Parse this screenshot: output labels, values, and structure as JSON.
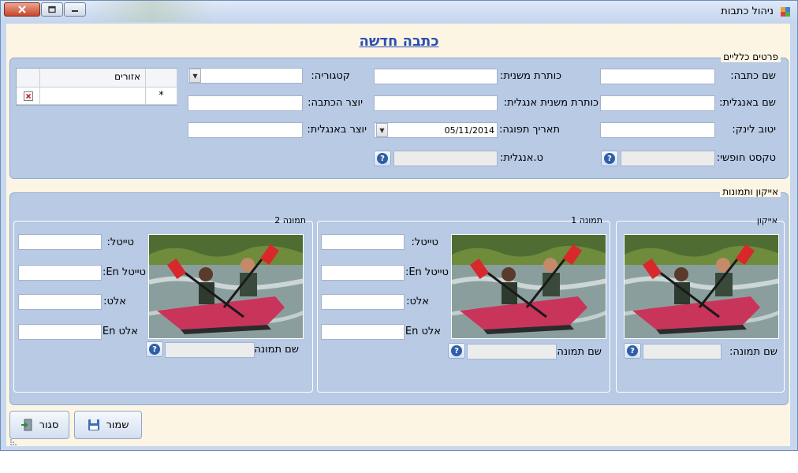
{
  "window": {
    "title": "ניהול כתבות"
  },
  "form_title": "כתבה חדשה",
  "general_group": {
    "title": "פרטים כלליים",
    "fields": {
      "article_name": {
        "label": "שם כתבה:",
        "value": ""
      },
      "english_name": {
        "label": "שם באנגלית:",
        "value": ""
      },
      "link_routing": {
        "label": "יטוב לינק:",
        "value": ""
      },
      "free_text": {
        "label": "טקסט חופשי:",
        "value": ""
      },
      "subtitle": {
        "label": "כותרת משנית:",
        "value": ""
      },
      "subtitle_en": {
        "label": "כותרת משנית אנגלית:",
        "value": ""
      },
      "expiry_date": {
        "label": "תאריך תפוגה:",
        "value": "05/11/2014"
      },
      "text_en": {
        "label": "ט.אנגלית:",
        "value": ""
      },
      "category": {
        "label": "קטגוריה:",
        "value": ""
      },
      "author": {
        "label": "יוצר הכתבה:",
        "value": ""
      },
      "author_en": {
        "label": "יוצר באנגלית:",
        "value": ""
      }
    },
    "grid": {
      "column_header": "אזורים",
      "new_row_marker": "*"
    }
  },
  "images_group": {
    "title": "אייקון ותמונות",
    "icon": {
      "title": "אייקון",
      "name_label": "שם תמונה:",
      "name_value": ""
    },
    "image1": {
      "title": "תמונה 1",
      "name_label": "שם תמונה:",
      "name_value": "",
      "title_label": "טייטל:",
      "title_en_label": "טייטל En:",
      "alt_label": "אלט:",
      "alt_en_label": "אלט En:"
    },
    "image2": {
      "title": "תמונה 2",
      "name_label": "שם תמונה:",
      "name_value": "",
      "title_label": "טייטל:",
      "title_en_label": "טייטל En:",
      "alt_label": "אלט:",
      "alt_en_label": "אלט En:"
    }
  },
  "buttons": {
    "save": "שמור",
    "close": "סגור"
  },
  "icons": {
    "help": "help-icon",
    "close": "close-icon",
    "maximize": "maximize-icon",
    "minimize": "minimize-icon",
    "dropdown": "dropdown-arrow-icon",
    "delete": "delete-icon",
    "save": "floppy-disk-icon",
    "exit": "exit-icon"
  },
  "colors": {
    "title_blue": "#2b4fb4",
    "group_bg": "#b8cae4",
    "content_bg": "#fdf5e3"
  }
}
